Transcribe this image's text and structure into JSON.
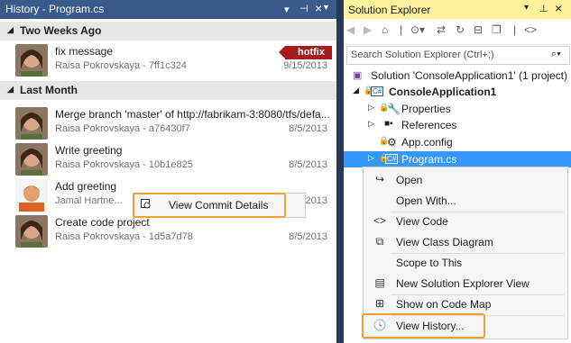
{
  "history": {
    "title": "History - Program.cs",
    "pin_glyph": "⊣",
    "close_glyph": "×",
    "dropdown_glyph": "▾",
    "groups": [
      {
        "label": "Two Weeks Ago",
        "commits": [
          {
            "message": "fix message",
            "author_hash": "Raisa Pokrovskaya - 7ff1c324",
            "date": "9/15/2013",
            "tag": "hotfix"
          }
        ]
      },
      {
        "label": "Last Month",
        "commits": [
          {
            "message": "Merge branch 'master' of http://fabrikam-3:8080/tfs/defa...",
            "author_hash": "Raisa Pokrovskaya - a76430f7",
            "date": "8/5/2013"
          },
          {
            "message": "Write greeting",
            "author_hash": "Raisa Pokrovskaya - 10b1e825",
            "date": "8/5/2013"
          },
          {
            "message": "Add greeting",
            "author_hash": "Jamal Hartne...",
            "date": "8/5/2013"
          },
          {
            "message": "Create code project",
            "author_hash": "Raisa Pokrovskaya - 1d5a7d78",
            "date": "8/5/2013"
          }
        ]
      }
    ],
    "context_menu": {
      "view_commit_details": "View Commit Details"
    }
  },
  "solution_explorer": {
    "title": "Solution Explorer",
    "search_placeholder": "Search Solution Explorer (Ctrl+;)",
    "tree": {
      "solution": "Solution 'ConsoleApplication1' (1 project)",
      "project": "ConsoleApplication1",
      "properties": "Properties",
      "references": "References",
      "app_config": "App.config",
      "program_cs": "Program.cs"
    },
    "context_menu": {
      "open": "Open",
      "open_with": "Open With...",
      "view_code": "View Code",
      "view_class_diagram": "View Class Diagram",
      "scope_to_this": "Scope to This",
      "new_view": "New Solution Explorer View",
      "show_on_code_map": "Show on Code Map",
      "view_history": "View History..."
    }
  },
  "colors": {
    "accent_highlight": "#f0a030",
    "selection": "#3399ff",
    "hotfix_tag": "#a51c1c",
    "frame": "#293955"
  }
}
